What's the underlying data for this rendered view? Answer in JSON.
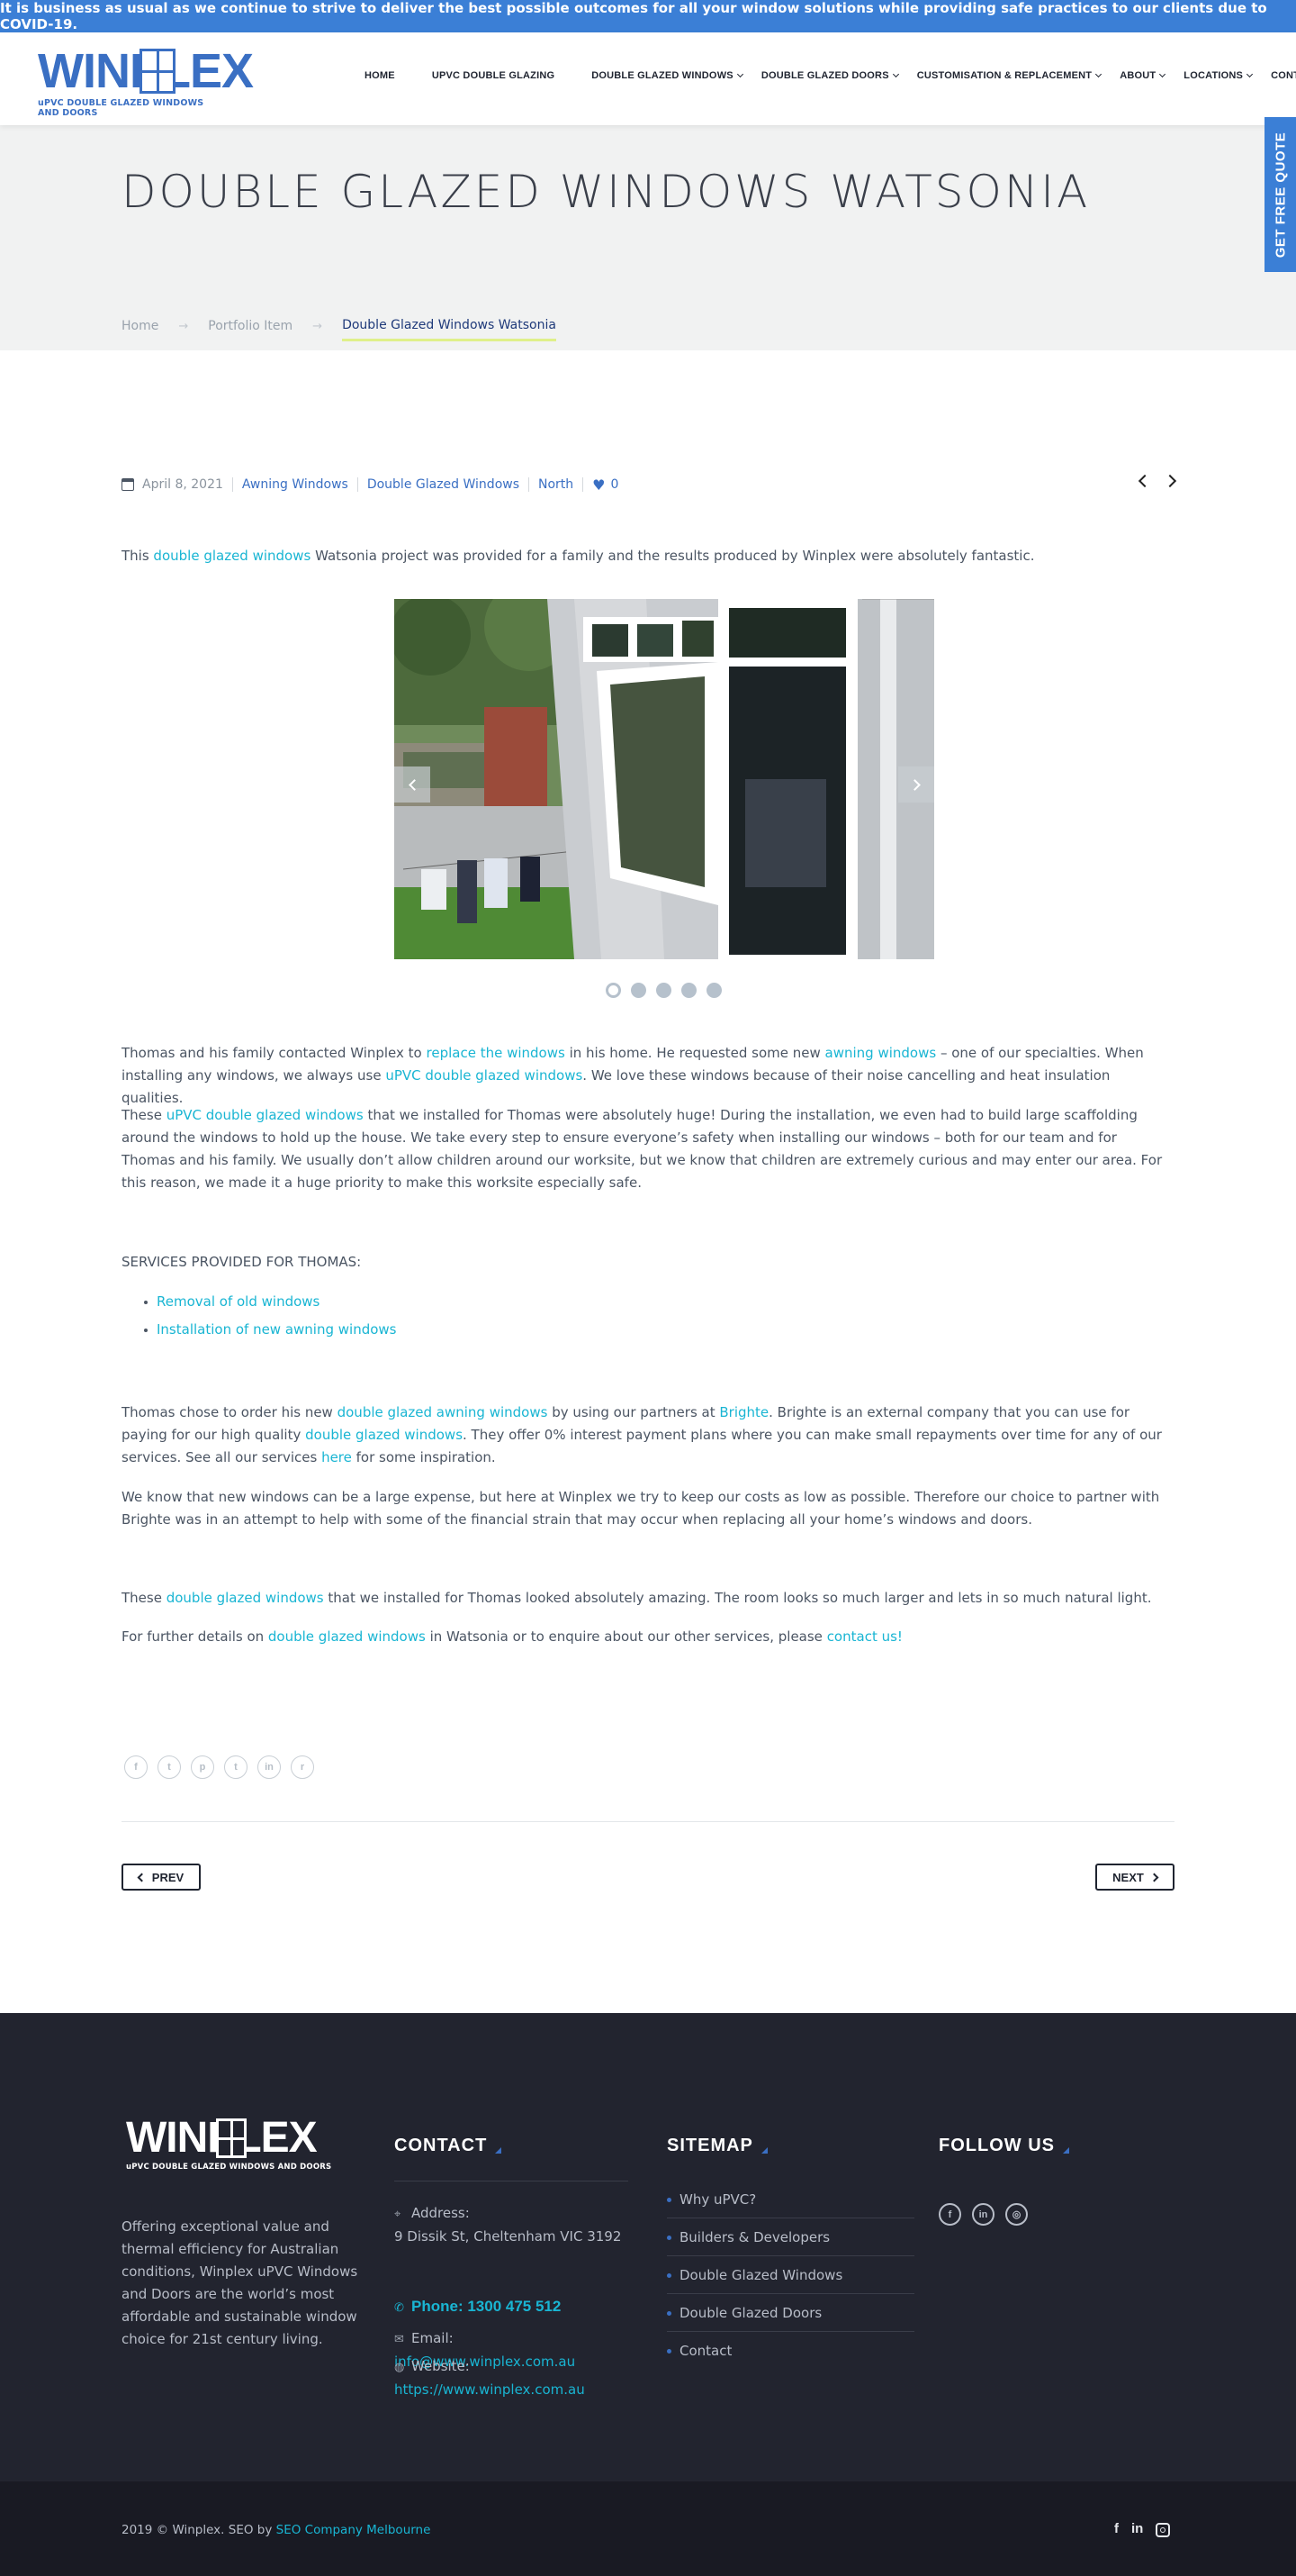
{
  "notice": {
    "text": "It is business as usual as we continue to strive to deliver the best possible outcomes for all your window solutions while providing safe practices to our clients due to COVID-19."
  },
  "header": {
    "logo_text": "WINPLEX",
    "logo_tagline": "uPVC DOUBLE GLAZED WINDOWS AND DOORS",
    "nav": [
      {
        "label": "HOME",
        "dropdown": false
      },
      {
        "label": "UPVC DOUBLE GLAZING",
        "dropdown": false
      },
      {
        "label": "DOUBLE GLAZED WINDOWS",
        "dropdown": true
      },
      {
        "label": "DOUBLE GLAZED DOORS",
        "dropdown": true
      },
      {
        "label": "CUSTOMISATION & REPLACEMENT",
        "dropdown": true
      },
      {
        "label": "ABOUT",
        "dropdown": true
      },
      {
        "label": "LOCATIONS",
        "dropdown": true
      },
      {
        "label": "CONTACT US",
        "dropdown": false
      }
    ]
  },
  "quote_tab": {
    "label": "GET FREE QUOTE"
  },
  "page": {
    "title": "DOUBLE GLAZED WINDOWS WATSONIA",
    "breadcrumb": {
      "home": "Home",
      "parent": "Portfolio Item",
      "current": "Double Glazed Windows Watsonia"
    }
  },
  "meta": {
    "date": "April 8, 2021",
    "categories": [
      "Awning Windows",
      "Double Glazed Windows",
      "North"
    ],
    "likes": "0"
  },
  "article": {
    "p1": {
      "a": "This ",
      "link": "double glazed windows",
      "b": " Watsonia project was provided for a family and the results produced by Winplex were absolutely fantastic."
    },
    "slider": {
      "slide_count": 5,
      "active_index": 0
    },
    "p2": {
      "a": "Thomas and his family contacted Winplex to ",
      "link1": "replace the windows",
      "b": " in his home. He requested some new ",
      "link2": "awning windows",
      "c": " – one of our specialties. When installing any windows, we always use ",
      "link3": "uPVC double glazed windows",
      "d": ". We love these windows because of their noise cancelling and heat insulation qualities."
    },
    "p3": {
      "a": "These ",
      "link": "uPVC double glazed windows",
      "b": " that we installed for Thomas were absolutely huge! During the installation, we even had to build large scaffolding around the windows to hold up the house. We take every step to ensure everyone’s safety when installing our windows – both for our team and for Thomas and his family. We usually don’t allow children around our worksite, but we know that children are extremely curious and may enter our area. For this reason, we made it a huge priority to make this worksite especially safe."
    },
    "services_title": "SERVICES PROVIDED FOR THOMAS:",
    "services": [
      "Removal of old windows",
      "Installation of new awning windows"
    ],
    "p4": {
      "a": "Thomas chose to order his new ",
      "link1": "double glazed awning windows",
      "b": " by using our partners at ",
      "link2": "Brighte",
      "c": ". Brighte is an external company that you can use for paying for our high quality ",
      "link3": "double glazed windows",
      "d": ". They offer 0% interest payment plans where you can make small repayments over time for any of our services. See all our services ",
      "link4": "here",
      "e": " for some inspiration."
    },
    "p5": "We know that new windows can be a large expense, but here at Winplex we try to keep our costs as low as possible. Therefore our choice to partner with Brighte was in an attempt to help with some of the financial strain that may occur when replacing all your home’s windows and doors.",
    "p6": {
      "a": "These ",
      "link": "double glazed windows",
      "b": " that we installed for Thomas looked absolutely amazing. The room looks so much larger and lets in so much natural light."
    },
    "p7": {
      "a": "For further details on ",
      "link1": "double glazed windows",
      "b": " in Watsonia or to enquire about our other services, please ",
      "link2": "contact us!"
    }
  },
  "share_icons": [
    "facebook-icon",
    "twitter-icon",
    "pinterest-icon",
    "tumblr-icon",
    "linkedin-icon",
    "reddit-icon"
  ],
  "pagination": {
    "prev": "PREV",
    "next": "NEXT"
  },
  "footer": {
    "logo_text": "WINPLEX",
    "logo_tagline": "uPVC DOUBLE GLAZED WINDOWS AND DOORS",
    "about": "Offering exceptional value and thermal efficiency for Australian conditions, Winplex uPVC Windows and Doors are the world’s most affordable and sustainable window choice for 21st century living.",
    "contact": {
      "heading": "CONTACT",
      "address_label": "Address:",
      "address": "9 Dissik St, Cheltenham VIC 3192",
      "phone": "Phone: 1300 475 512",
      "email_label": "Email:",
      "email": "info@www.winplex.com.au",
      "website_label": "Website:",
      "website": "https://www.winplex.com.au"
    },
    "sitemap": {
      "heading": "SITEMAP",
      "items": [
        "Why uPVC?",
        "Builders & Developers",
        "Double Glazed Windows",
        "Double Glazed Doors",
        "Contact"
      ]
    },
    "follow": {
      "heading": "FOLLOW US",
      "icons": [
        "facebook-icon",
        "linkedin-icon",
        "instagram-icon"
      ]
    }
  },
  "bottom": {
    "copyright": "2019 © Winplex. SEO by ",
    "seo_link": "SEO Company Melbourne"
  },
  "colors": {
    "brand_blue": "#3b7fd6",
    "link_cyan": "#19b5d3",
    "footer_bg": "#22242f",
    "bottom_bg": "#191a23"
  }
}
